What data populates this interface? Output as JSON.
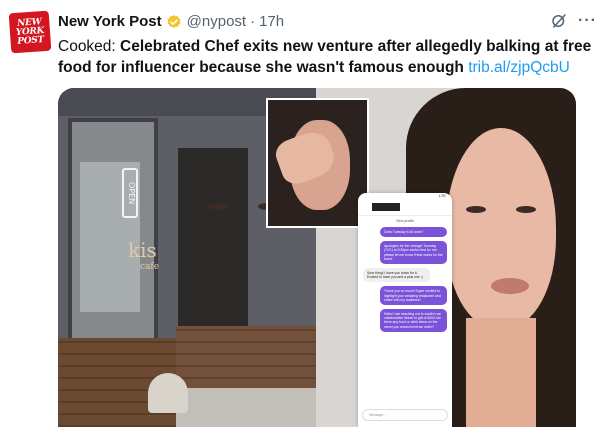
{
  "tweet": {
    "avatar_line1": "NEW",
    "avatar_line2": "YORK",
    "avatar_line3": "POST",
    "name": "New York Post",
    "handle": "@nypost",
    "separator": "·",
    "time": "17h",
    "prefix": "Cooked:",
    "headline": "Celebrated Chef exits new venture after allegedly balking at free food for influencer because she wasn't famous enough",
    "link": "trib.al/zjpQcbU",
    "more_label": "···"
  },
  "media": {
    "sign_open": "OPEN",
    "sign_kis": "kis",
    "sign_cafe": "cafe",
    "phone": {
      "status": "LTE",
      "pill": "View profile",
      "messages": [
        {
          "from": "me",
          "text": "Does Tuesday 6:30 work?"
        },
        {
          "from": "them",
          "text": "Apologies for the change! Tuesday (7/21) at 5:30pm works best for me - please let me know if that works for the team!"
        },
        {
          "from": "them",
          "text": "Sure thing! I have you down for 6. Excited to have you and a plus one :)"
        },
        {
          "from": "me",
          "text": "Thank you so much! Super excited to highlight your amazing restaurant and share with my audience!"
        },
        {
          "from": "me",
          "text": "Hello! I am reaching out to confirm we collaborative dinner to gift of $200 Are there any food or drink items on the menu you recommend we order?"
        }
      ],
      "input_placeholder": "Message..."
    }
  },
  "colors": {
    "link": "#1d9bf0",
    "verified": "#f4c430",
    "brand_red": "#d3161f",
    "dm_bubble": "#7a53d9"
  },
  "icons": {
    "verified": "verified-badge-icon",
    "grok": "grok-icon",
    "more": "more-options-icon"
  }
}
